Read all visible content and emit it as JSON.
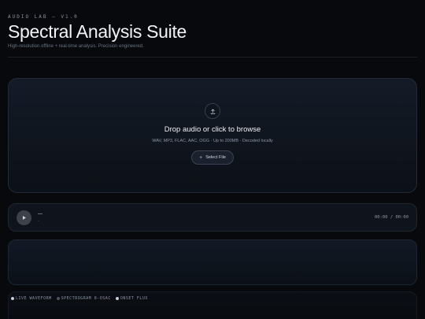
{
  "header": {
    "kicker": "AUDIO LAB — V1.0",
    "title": "Spectral Analysis Suite",
    "tagline": "High-resolution offline + real-time analysis. Precision engineered."
  },
  "dropzone": {
    "icon": "upload-icon",
    "title": "Drop audio or click to browse",
    "subtitle": "WAV, MP3, FLAC, AAC, OGG · Up to 200MB · Decoded locally",
    "button_label": "Select File"
  },
  "player": {
    "icon": "play-icon",
    "track_name": "—",
    "track_meta": "-",
    "time": "00:00 / 00:00"
  },
  "modes": [
    {
      "label": "LIVE WAVEFORM",
      "active": true
    },
    {
      "label": "SPECTROGRAM 8-OSAC",
      "active": false
    },
    {
      "label": "ONSET FLUX",
      "active": true
    }
  ],
  "colors": {
    "background": "#07090d",
    "panel": "#141b27",
    "text": "#eef1f5",
    "muted": "#8d96a4"
  }
}
